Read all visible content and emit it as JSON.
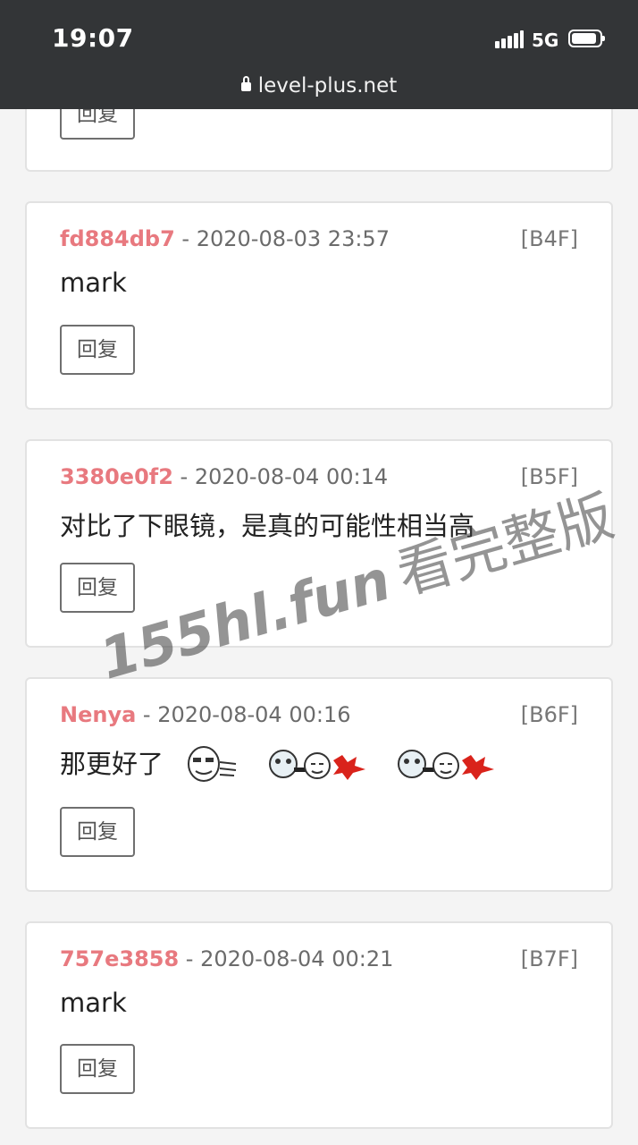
{
  "status_bar": {
    "time": "19:07",
    "network": "5G"
  },
  "browser": {
    "url": "level-plus.net"
  },
  "reply_label": "回复",
  "posts": [
    {
      "user": "",
      "time": "",
      "floor": "",
      "text": ""
    },
    {
      "user": "fd884db7",
      "time": " - 2020-08-03 23:57",
      "floor": "[B4F]",
      "text": "mark"
    },
    {
      "user": "3380e0f2",
      "time": " - 2020-08-04 00:14",
      "floor": "[B5F]",
      "text": "对比了下眼镜，是真的可能性相当高"
    },
    {
      "user": "Nenya",
      "time": " - 2020-08-04 00:16",
      "floor": "[B6F]",
      "text": "那更好了",
      "emoji_icons": [
        "meme-face-emoji",
        "meme-shooting-emoji",
        "meme-shooting-emoji"
      ]
    },
    {
      "user": "757e3858",
      "time": " - 2020-08-04 00:21",
      "floor": "[B7F]",
      "text": "mark"
    }
  ],
  "watermark": {
    "site": "155hl.fun",
    "text": "看完整版"
  }
}
